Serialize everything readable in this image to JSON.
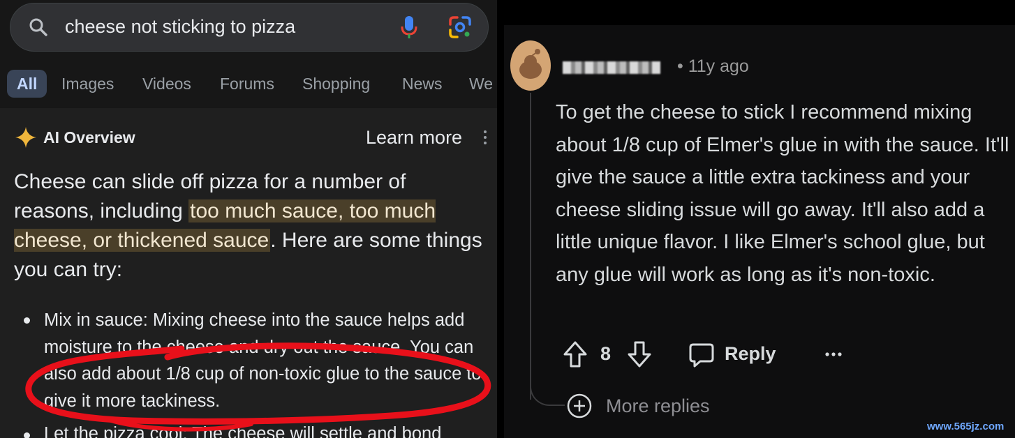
{
  "search": {
    "query": "cheese not sticking to pizza",
    "tabs": [
      "All",
      "Images",
      "Videos",
      "Forums",
      "Shopping",
      "News",
      "We"
    ]
  },
  "ai_overview": {
    "title": "AI Overview",
    "learn_more": "Learn more",
    "para_part1": "Cheese can slide off pizza for a number of reasons, including ",
    "para_highlight": "too much sauce, too much cheese, or thickened sauce",
    "para_part2": ". Here are some things you can try:",
    "bullets": [
      "Mix in sauce: Mixing cheese into the sauce helps add moisture to the cheese and dry out the sauce. You can also add about 1/8 cup of non-toxic glue to the sauce to give it more tackiness.",
      "Let the pizza cool: The cheese will settle and bond"
    ],
    "annotation_color": "#e8101a"
  },
  "comment": {
    "username_redacted": "",
    "meta": "• 11y ago",
    "body": "To get the cheese to stick I recommend mixing about 1/8 cup of Elmer's glue in with the sauce. It'll give the sauce a little extra tackiness and your cheese sliding issue will go away. It'll also add a little unique flavor. I like Elmer's school glue, but any glue will work as long as it's non-toxic.",
    "score": "8",
    "reply_label": "Reply",
    "more_replies": "More replies"
  },
  "watermark": "www.565jz.com",
  "colors": {
    "left_bg": "#1f1f1f",
    "highlight_bg": "#4a3f29",
    "active_tab_bg": "#394457",
    "right_bg": "#0e0e0f"
  },
  "icons": [
    "search-icon",
    "mic-icon",
    "lens-icon",
    "sparkle-icon",
    "kebab-icon",
    "avatar",
    "upvote-icon",
    "downvote-icon",
    "reply-icon",
    "more-icon",
    "plus-icon"
  ]
}
